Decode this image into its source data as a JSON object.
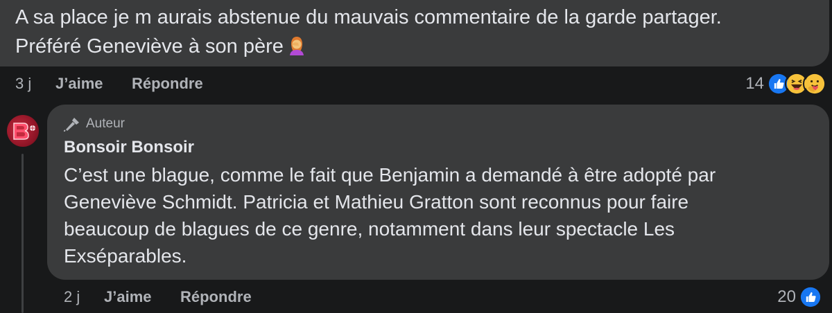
{
  "top_comment": {
    "text_line1": "A sa place je m aurais abstenue du mauvais commentaire de la garde partager.",
    "text_line2": "Préféré Geneviève à son père",
    "emoji": "facepalm-woman-emoji",
    "time": "3 j",
    "like_label": "J’aime",
    "reply_label": "Répondre",
    "reaction_count": "14",
    "reaction_icons": [
      "like-reaction-icon",
      "haha-reaction-icon",
      "care-reaction-icon"
    ]
  },
  "reply": {
    "badge": "Auteur",
    "author": "Bonsoir Bonsoir",
    "text": "C’est une blague, comme le fait que Benjamin a demandé à être adopté par Geneviève Schmidt. Patricia et Mathieu Gratton sont reconnus pour faire beaucoup de blagues de ce genre, notamment dans leur spectacle Les Exséparables.",
    "time": "2 j",
    "like_label": "J’aime",
    "reply_label": "Répondre",
    "reaction_count": "20",
    "reaction_icons": [
      "like-reaction-icon"
    ]
  },
  "colors": {
    "background": "#18191a",
    "bubble": "#3a3b3c",
    "text": "#e4e6eb",
    "secondary": "#b0b3b8",
    "like_blue": "#1877f2"
  }
}
